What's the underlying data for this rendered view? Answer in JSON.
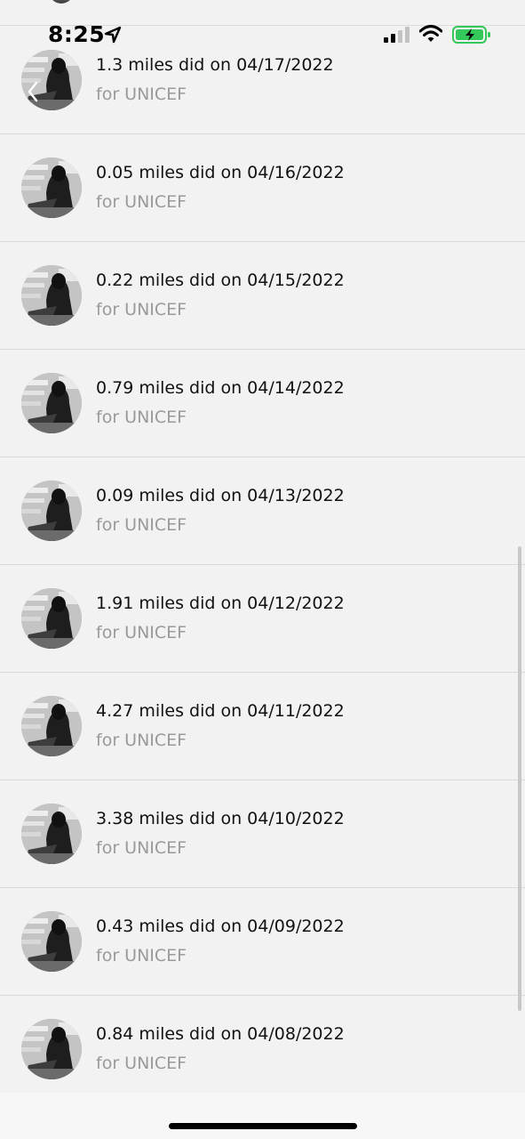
{
  "status_bar": {
    "time": "8:25"
  },
  "list": {
    "items": [
      {
        "title": "1.3 miles did on 04/17/2022",
        "subtitle": "for UNICEF"
      },
      {
        "title": "0.05 miles did on 04/16/2022",
        "subtitle": "for UNICEF"
      },
      {
        "title": "0.22 miles did on 04/15/2022",
        "subtitle": "for UNICEF"
      },
      {
        "title": "0.79 miles did on 04/14/2022",
        "subtitle": "for UNICEF"
      },
      {
        "title": "0.09 miles did on 04/13/2022",
        "subtitle": "for UNICEF"
      },
      {
        "title": "1.91 miles did on 04/12/2022",
        "subtitle": "for UNICEF"
      },
      {
        "title": "4.27 miles did on 04/11/2022",
        "subtitle": "for UNICEF"
      },
      {
        "title": "3.38 miles did on 04/10/2022",
        "subtitle": "for UNICEF"
      },
      {
        "title": "0.43 miles did on 04/09/2022",
        "subtitle": "for UNICEF"
      },
      {
        "title": "0.84 miles did on 04/08/2022",
        "subtitle": "for UNICEF"
      }
    ]
  },
  "colors": {
    "background": "#f2f2f2",
    "title_text": "#111111",
    "subtitle_text": "#9a9a9a",
    "divider": "#d9d9d9",
    "battery_fill": "#34c759"
  },
  "icons": {
    "location": "location-arrow-icon",
    "signal": "cellular-signal-icon",
    "wifi": "wifi-icon",
    "battery": "battery-charging-icon",
    "back": "chevron-left-icon"
  }
}
